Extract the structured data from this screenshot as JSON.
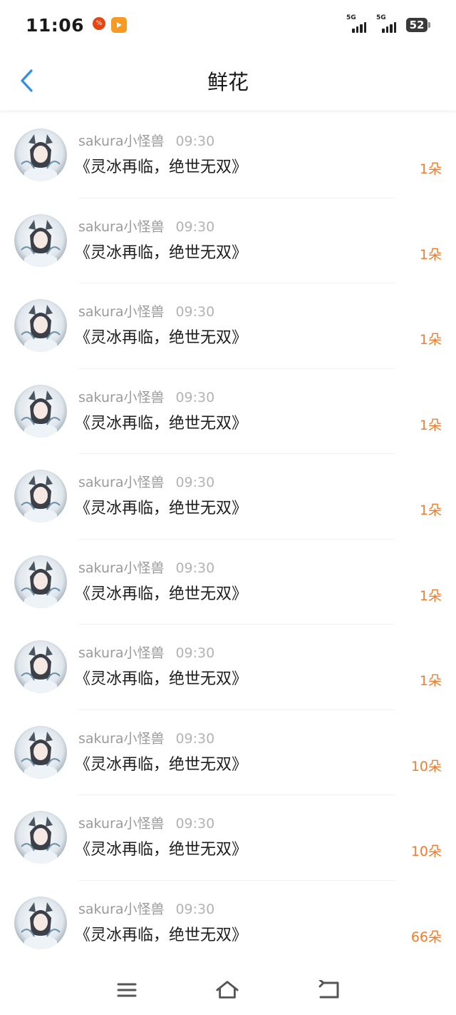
{
  "status": {
    "time": "11:06",
    "network_1": "5G",
    "network_2": "5G",
    "battery": "52"
  },
  "header": {
    "title": "鲜花"
  },
  "items": [
    {
      "user": "sakura小怪兽",
      "time": "09:30",
      "book": "《灵冰再临，绝世无双》",
      "count": "1朵"
    },
    {
      "user": "sakura小怪兽",
      "time": "09:30",
      "book": "《灵冰再临，绝世无双》",
      "count": "1朵"
    },
    {
      "user": "sakura小怪兽",
      "time": "09:30",
      "book": "《灵冰再临，绝世无双》",
      "count": "1朵"
    },
    {
      "user": "sakura小怪兽",
      "time": "09:30",
      "book": "《灵冰再临，绝世无双》",
      "count": "1朵"
    },
    {
      "user": "sakura小怪兽",
      "time": "09:30",
      "book": "《灵冰再临，绝世无双》",
      "count": "1朵"
    },
    {
      "user": "sakura小怪兽",
      "time": "09:30",
      "book": "《灵冰再临，绝世无双》",
      "count": "1朵"
    },
    {
      "user": "sakura小怪兽",
      "time": "09:30",
      "book": "《灵冰再临，绝世无双》",
      "count": "1朵"
    },
    {
      "user": "sakura小怪兽",
      "time": "09:30",
      "book": "《灵冰再临，绝世无双》",
      "count": "10朵"
    },
    {
      "user": "sakura小怪兽",
      "time": "09:30",
      "book": "《灵冰再临，绝世无双》",
      "count": "10朵"
    },
    {
      "user": "sakura小怪兽",
      "time": "09:30",
      "book": "《灵冰再临，绝世无双》",
      "count": "66朵"
    }
  ],
  "colors": {
    "accent": "#2f8fe8",
    "count": "#ee7d2e",
    "meta": "#9a9a9a"
  },
  "icons": {
    "back": "chevron-left-icon",
    "menu": "menu-icon",
    "home": "home-icon",
    "return": "return-icon"
  }
}
